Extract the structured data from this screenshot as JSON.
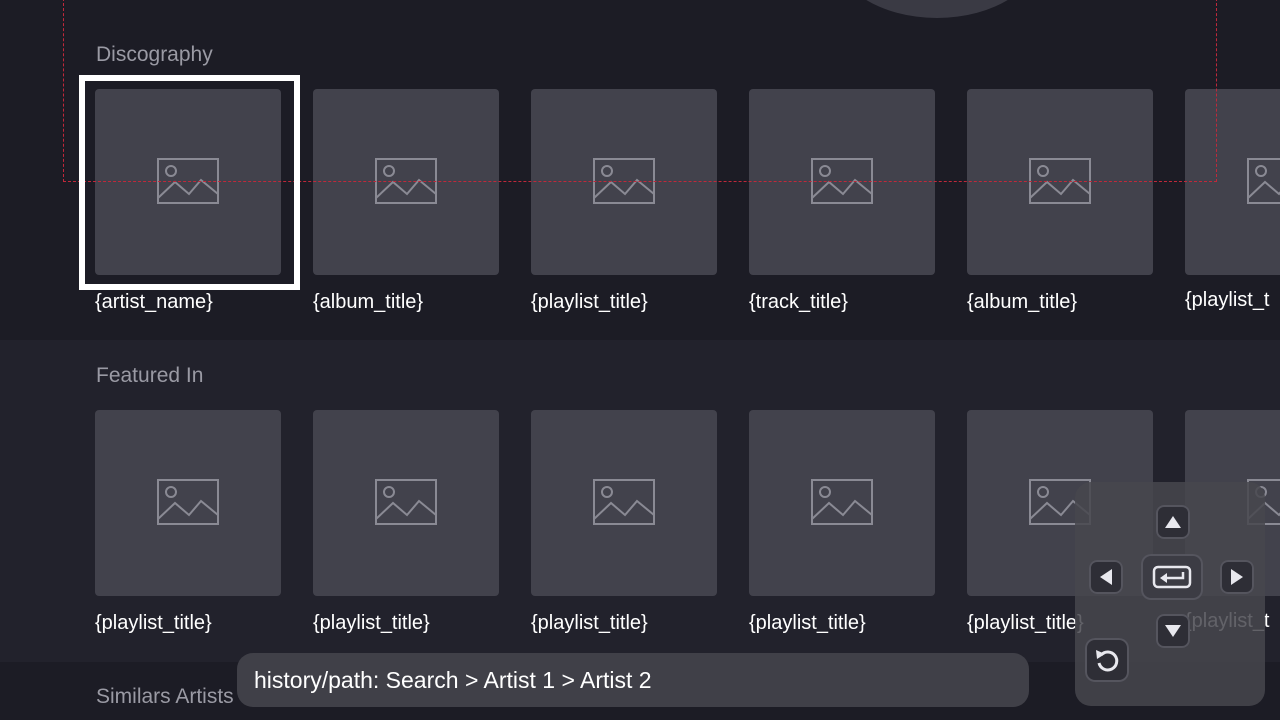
{
  "sections": {
    "discography_label": "Discography",
    "featured_label": "Featured In",
    "similars_label": "Similars Artists"
  },
  "discography": [
    {
      "title": "{artist_name}"
    },
    {
      "title": "{album_title}"
    },
    {
      "title": "{playlist_title}"
    },
    {
      "title": "{track_title}"
    },
    {
      "title": "{album_title}"
    },
    {
      "title": "{playlist_t"
    }
  ],
  "featured": [
    {
      "title": "{playlist_title}"
    },
    {
      "title": "{playlist_title}"
    },
    {
      "title": "{playlist_title}"
    },
    {
      "title": "{playlist_title}"
    },
    {
      "title": "{playlist_title}"
    },
    {
      "title": "{playlist_t"
    }
  ],
  "history": {
    "text": "history/path: Search > Artist 1 > Artist 2"
  },
  "remote": {
    "up": "arrow-up-icon",
    "down": "arrow-down-icon",
    "left": "arrow-left-icon",
    "right": "arrow-right-icon",
    "ok": "enter-icon",
    "back": "back-icon"
  },
  "colors": {
    "background": "#1c1c25",
    "card": "#42424c",
    "focus": "#ffffff",
    "debug_outline": "#c0283a"
  }
}
